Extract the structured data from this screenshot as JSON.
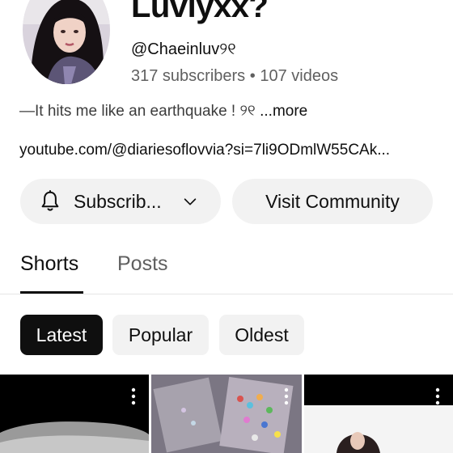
{
  "channel": {
    "title": "Luvlyxx?",
    "handle": "@Chaeinluv୨୧",
    "subscribers": "317 subscribers",
    "separator": "•",
    "videos": "107 videos",
    "description": "—It hits me like an earthquake ! ୨୧ ",
    "more_label": "...more",
    "link": "youtube.com/@diariesoflovvia?si=7li9ODmlW55CAk..."
  },
  "actions": {
    "subscribe_label": "Subscrib...",
    "community_label": "Visit Community"
  },
  "tabs": [
    {
      "label": "Shorts",
      "active": true
    },
    {
      "label": "Posts",
      "active": false
    }
  ],
  "filters": [
    {
      "label": "Latest",
      "active": true
    },
    {
      "label": "Popular",
      "active": false
    },
    {
      "label": "Oldest",
      "active": false
    }
  ],
  "icons": {
    "subscribe": "bell-icon",
    "dropdown": "chevron-down-icon",
    "overflow": "more-vert-icon"
  },
  "colors": {
    "text_primary": "#0f0f0f",
    "text_secondary": "#606060",
    "pill_bg": "#f2f2f2",
    "chip_active_bg": "#0f0f0f"
  }
}
